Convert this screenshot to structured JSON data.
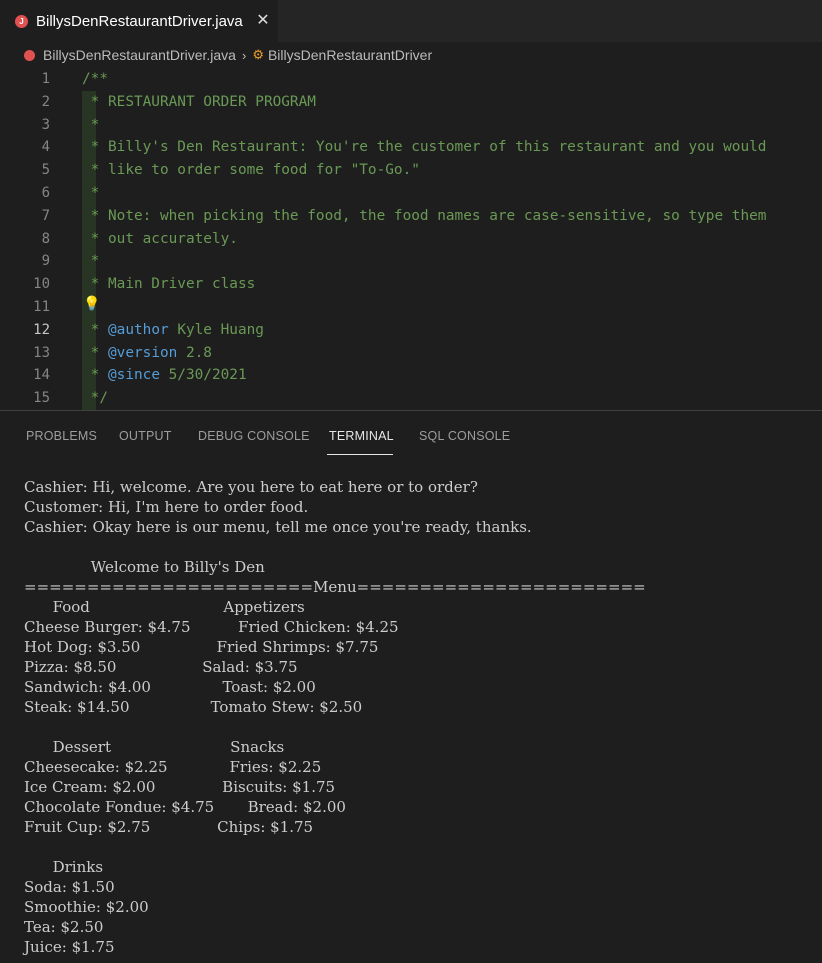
{
  "tab": {
    "label": "BillysDenRestaurantDriver.java",
    "close": "✕"
  },
  "breadcrumb": {
    "file": "BillysDenRestaurantDriver.java",
    "symbol": "BillysDenRestaurantDriver"
  },
  "editor": {
    "line_numbers": [
      "1",
      "2",
      "3",
      "4",
      "5",
      "6",
      "7",
      "8",
      "9",
      "10",
      "11",
      "12",
      "13",
      "14",
      "15"
    ],
    "active_line": "12",
    "lines": [
      "/**",
      " * RESTAURANT ORDER PROGRAM",
      " *",
      " * Billy's Den Restaurant: You're the customer of this restaurant and you would",
      " * like to order some food for \"To-Go.\"",
      " *",
      " * Note: when picking the food, the food names are case-sensitive, so type them",
      " * out accurately.",
      " *",
      " * Main Driver class",
      "",
      " * @author Kyle Huang",
      " * @version 2.8",
      " * @since 5/30/2021",
      " */"
    ]
  },
  "panel": {
    "tabs": [
      "PROBLEMS",
      "OUTPUT",
      "DEBUG CONSOLE",
      "TERMINAL",
      "SQL CONSOLE"
    ],
    "active_tab": "TERMINAL"
  },
  "terminal": {
    "lines": [
      "Cashier: Hi, welcome. Are you here to eat here or to order?",
      "Customer: Hi, I'm here to order food.",
      "Cashier: Okay here is our menu, tell me once you're ready, thanks.",
      "",
      "              Welcome to Billy's Den",
      "=======================Menu=======================",
      "      Food                            Appetizers",
      "Cheese Burger: $4.75          Fried Chicken: $4.25",
      "Hot Dog: $3.50                Fried Shrimps: $7.75",
      "Pizza: $8.50                  Salad: $3.75",
      "Sandwich: $4.00               Toast: $2.00",
      "Steak: $14.50                 Tomato Stew: $2.50",
      "",
      "      Dessert                         Snacks",
      "Cheesecake: $2.25             Fries: $2.25",
      "Ice Cream: $2.00              Biscuits: $1.75",
      "Chocolate Fondue: $4.75       Bread: $2.00",
      "Fruit Cup: $2.75              Chips: $1.75",
      "",
      "      Drinks",
      "Soda: $1.50",
      "Smoothie: $2.00",
      "Tea: $2.50",
      "Juice: $1.75"
    ]
  },
  "colors": {
    "comment": "#6a9955",
    "javadoc_tag": "#569cd6",
    "java_icon": "#e05252",
    "bulb": "#ffcc00"
  }
}
